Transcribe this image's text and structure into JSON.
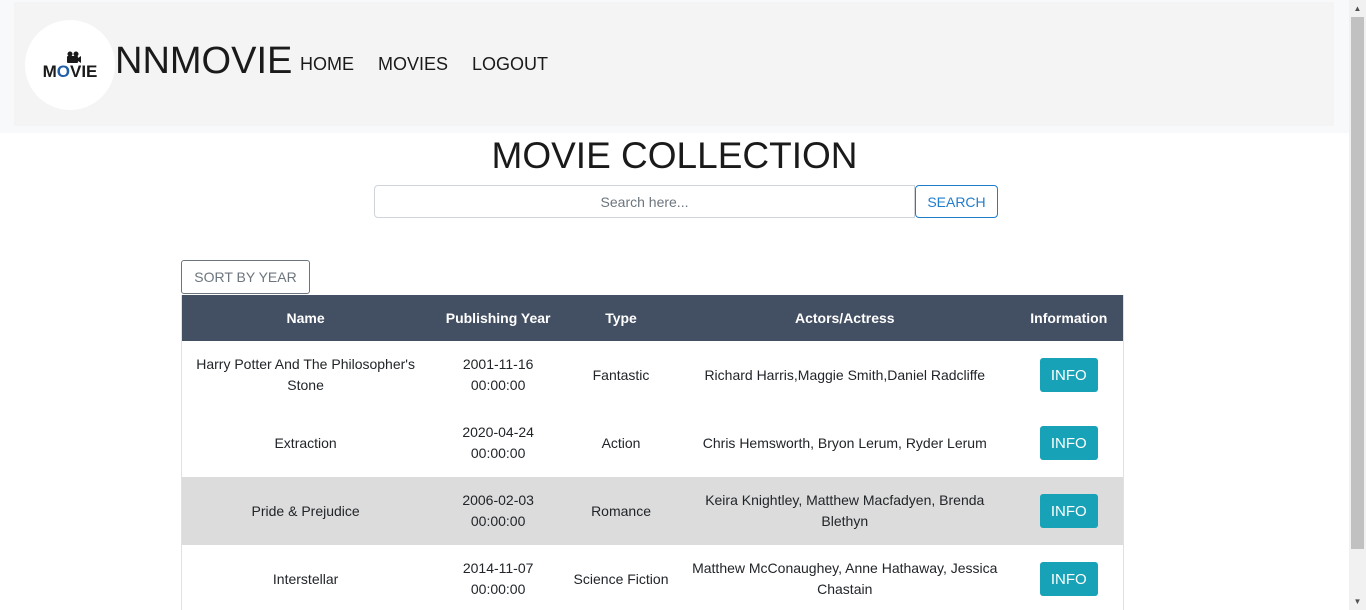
{
  "header": {
    "logo_text_left": "M",
    "logo_text_o": "O",
    "logo_text_right": "VIE",
    "brand": "NNMOVIE",
    "nav": [
      {
        "label": "HOME"
      },
      {
        "label": "MOVIES"
      },
      {
        "label": "LOGOUT"
      }
    ]
  },
  "main": {
    "title": "MOVIE COLLECTION",
    "search": {
      "placeholder": "Search here...",
      "value": "",
      "button_label": "SEARCH"
    },
    "sort_label": "SORT BY YEAR",
    "table": {
      "columns": [
        "Name",
        "Publishing Year",
        "Type",
        "Actors/Actress",
        "Information"
      ],
      "rows": [
        {
          "name": "Harry Potter And The Philosopher's Stone",
          "date": "2001-11-16",
          "time": "00:00:00",
          "type": "Fantastic",
          "actors": "Richard Harris,Maggie Smith,Daniel Radcliffe",
          "info_label": "INFO"
        },
        {
          "name": "Extraction",
          "date": "2020-04-24",
          "time": "00:00:00",
          "type": "Action",
          "actors": "Chris Hemsworth, Bryon Lerum, Ryder Lerum",
          "info_label": "INFO"
        },
        {
          "name": "Pride & Prejudice",
          "date": "2006-02-03",
          "time": "00:00:00",
          "type": "Romance",
          "actors": "Keira Knightley, Matthew Macfadyen, Brenda Blethyn",
          "info_label": "INFO"
        },
        {
          "name": "Interstellar",
          "date": "2014-11-07",
          "time": "00:00:00",
          "type": "Science Fiction",
          "actors": "Matthew McConaughey, Anne Hathaway, Jessica Chastain",
          "info_label": "INFO"
        }
      ]
    }
  },
  "colors": {
    "table_header": "#434f62",
    "info_button": "#17a2b8",
    "search_button": "#1f7dcb",
    "highlight_row": "#dcdcdc"
  }
}
